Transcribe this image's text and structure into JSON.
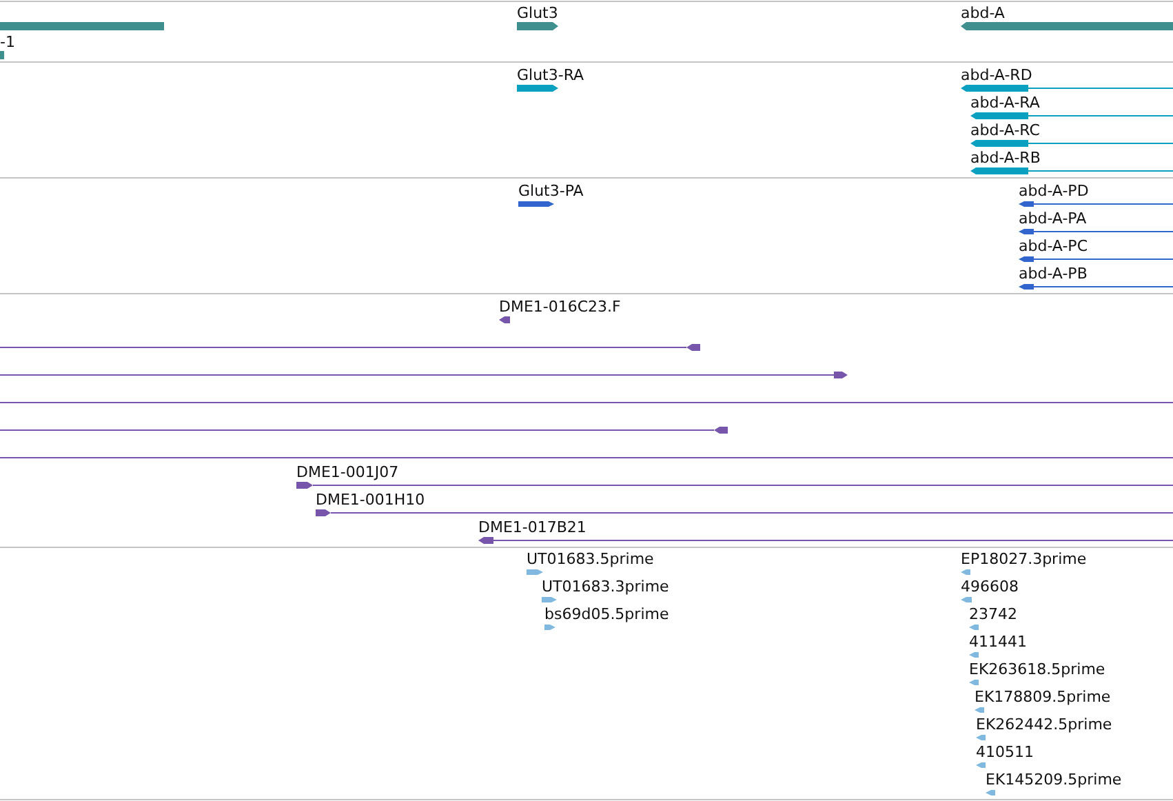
{
  "tracks": [
    {
      "color": "#3f8f8f",
      "features": [
        {
          "kind": "plain"
        },
        {
          "label": "-1",
          "kind": "plain"
        },
        {
          "label": "Glut3",
          "kind": "forward"
        },
        {
          "label": "abd-A",
          "kind": "reverse"
        }
      ]
    },
    {
      "color": "#0aa0bf",
      "features": [
        {
          "label": "Glut3-RA",
          "kind": "forward"
        },
        {
          "label": "abd-A-RD",
          "kind": "reverse"
        },
        {
          "label": "abd-A-RA",
          "kind": "reverse"
        },
        {
          "label": "abd-A-RC",
          "kind": "reverse"
        },
        {
          "label": "abd-A-RB",
          "kind": "reverse"
        }
      ]
    },
    {
      "color": "#3366cc",
      "features": [
        {
          "label": "Glut3-PA",
          "kind": "forward"
        },
        {
          "label": "abd-A-PD",
          "kind": "reverse"
        },
        {
          "label": "abd-A-PA",
          "kind": "reverse"
        },
        {
          "label": "abd-A-PC",
          "kind": "reverse"
        },
        {
          "label": "abd-A-PB",
          "kind": "reverse"
        }
      ]
    },
    {
      "color": "#7755aa",
      "features": [
        {
          "label": "DME1-016C23.F",
          "kind": "reverse"
        },
        {
          "kind": "reverse"
        },
        {
          "kind": "forward"
        },
        {
          "kind": "line"
        },
        {
          "kind": "reverse"
        },
        {
          "kind": "line"
        },
        {
          "label": "DME1-001J07",
          "kind": "forward"
        },
        {
          "label": "DME1-001H10",
          "kind": "forward"
        },
        {
          "label": "DME1-017B21",
          "kind": "reverse"
        }
      ]
    },
    {
      "color": "#80b8e0",
      "features": [
        {
          "label": "UT01683.5prime",
          "kind": "forward"
        },
        {
          "label": "UT01683.3prime",
          "kind": "forward"
        },
        {
          "label": "bs69d05.5prime",
          "kind": "forward"
        },
        {
          "label": "EP18027.3prime",
          "kind": "reverse"
        },
        {
          "label": "496608",
          "kind": "reverse"
        },
        {
          "label": "23742",
          "kind": "reverse"
        },
        {
          "label": "411441",
          "kind": "reverse"
        },
        {
          "label": "EK263618.5prime",
          "kind": "reverse"
        },
        {
          "label": "EK178809.5prime",
          "kind": "reverse"
        },
        {
          "label": "EK262442.5prime",
          "kind": "reverse"
        },
        {
          "label": "410511",
          "kind": "reverse"
        },
        {
          "label": "EK145209.5prime",
          "kind": "reverse"
        }
      ]
    }
  ]
}
